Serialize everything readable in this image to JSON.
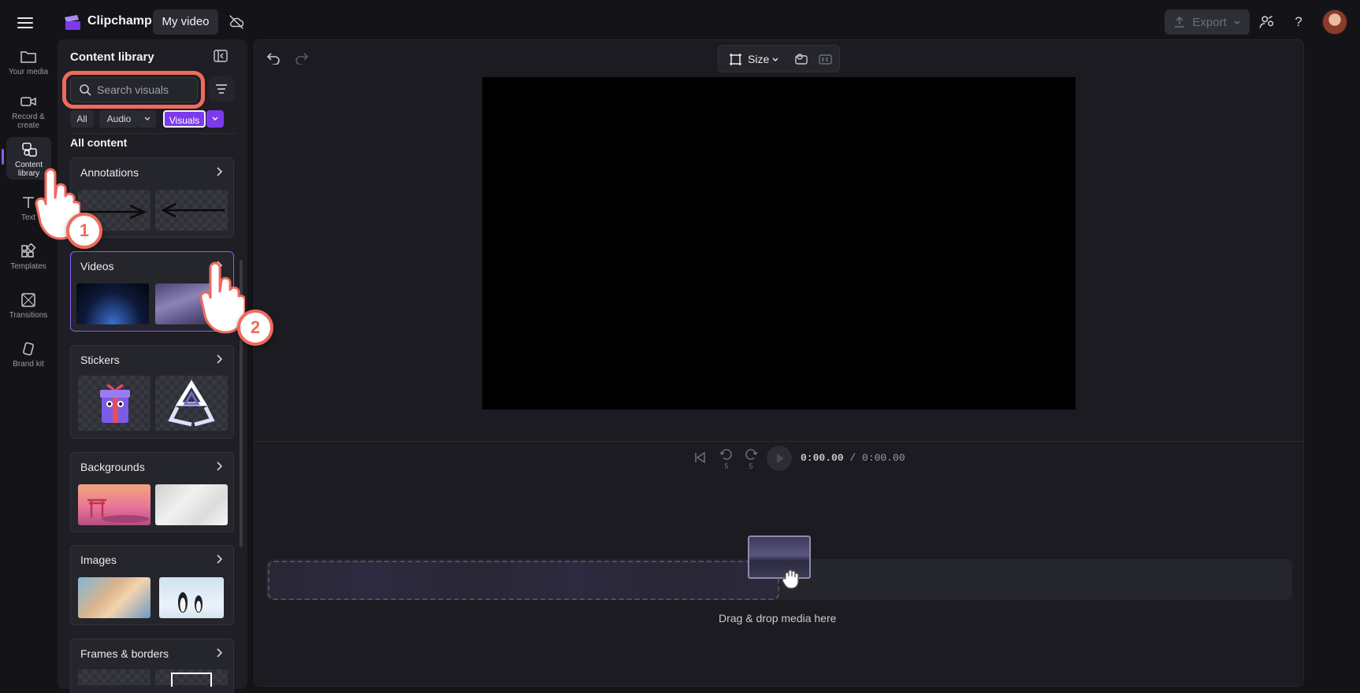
{
  "topbar": {
    "app_name": "Clipchamp",
    "project_name": "My video",
    "export_label": "Export",
    "help_label": "?"
  },
  "rail": {
    "items": [
      {
        "label": "Your media",
        "icon": "folder-icon"
      },
      {
        "label": "Record & create",
        "icon": "camera-icon"
      },
      {
        "label": "Content library",
        "icon": "content-library-icon",
        "active": true
      },
      {
        "label": "Text",
        "icon": "text-icon"
      },
      {
        "label": "Templates",
        "icon": "templates-icon"
      },
      {
        "label": "Transitions",
        "icon": "transitions-icon"
      },
      {
        "label": "Brand kit",
        "icon": "brand-kit-icon"
      }
    ]
  },
  "library": {
    "title": "Content library",
    "search_placeholder": "Search visuals",
    "filters": {
      "all": "All",
      "audio": "Audio",
      "visuals": "Visuals"
    },
    "section_label": "All content",
    "cards": [
      {
        "title": "Annotations"
      },
      {
        "title": "Videos"
      },
      {
        "title": "Stickers"
      },
      {
        "title": "Backgrounds"
      },
      {
        "title": "Images"
      },
      {
        "title": "Frames & borders"
      }
    ]
  },
  "editor": {
    "size_label": "Size",
    "time_current": "0:00.00",
    "time_total": "/ 0:00.00",
    "rewind_seconds": "5",
    "forward_seconds": "5",
    "drop_hint": "Drag & drop media here"
  },
  "annotations": {
    "step1": "1",
    "step2": "2"
  },
  "colors": {
    "accent": "#7c3aed",
    "highlight": "#f06a5c",
    "background": "#141418"
  }
}
